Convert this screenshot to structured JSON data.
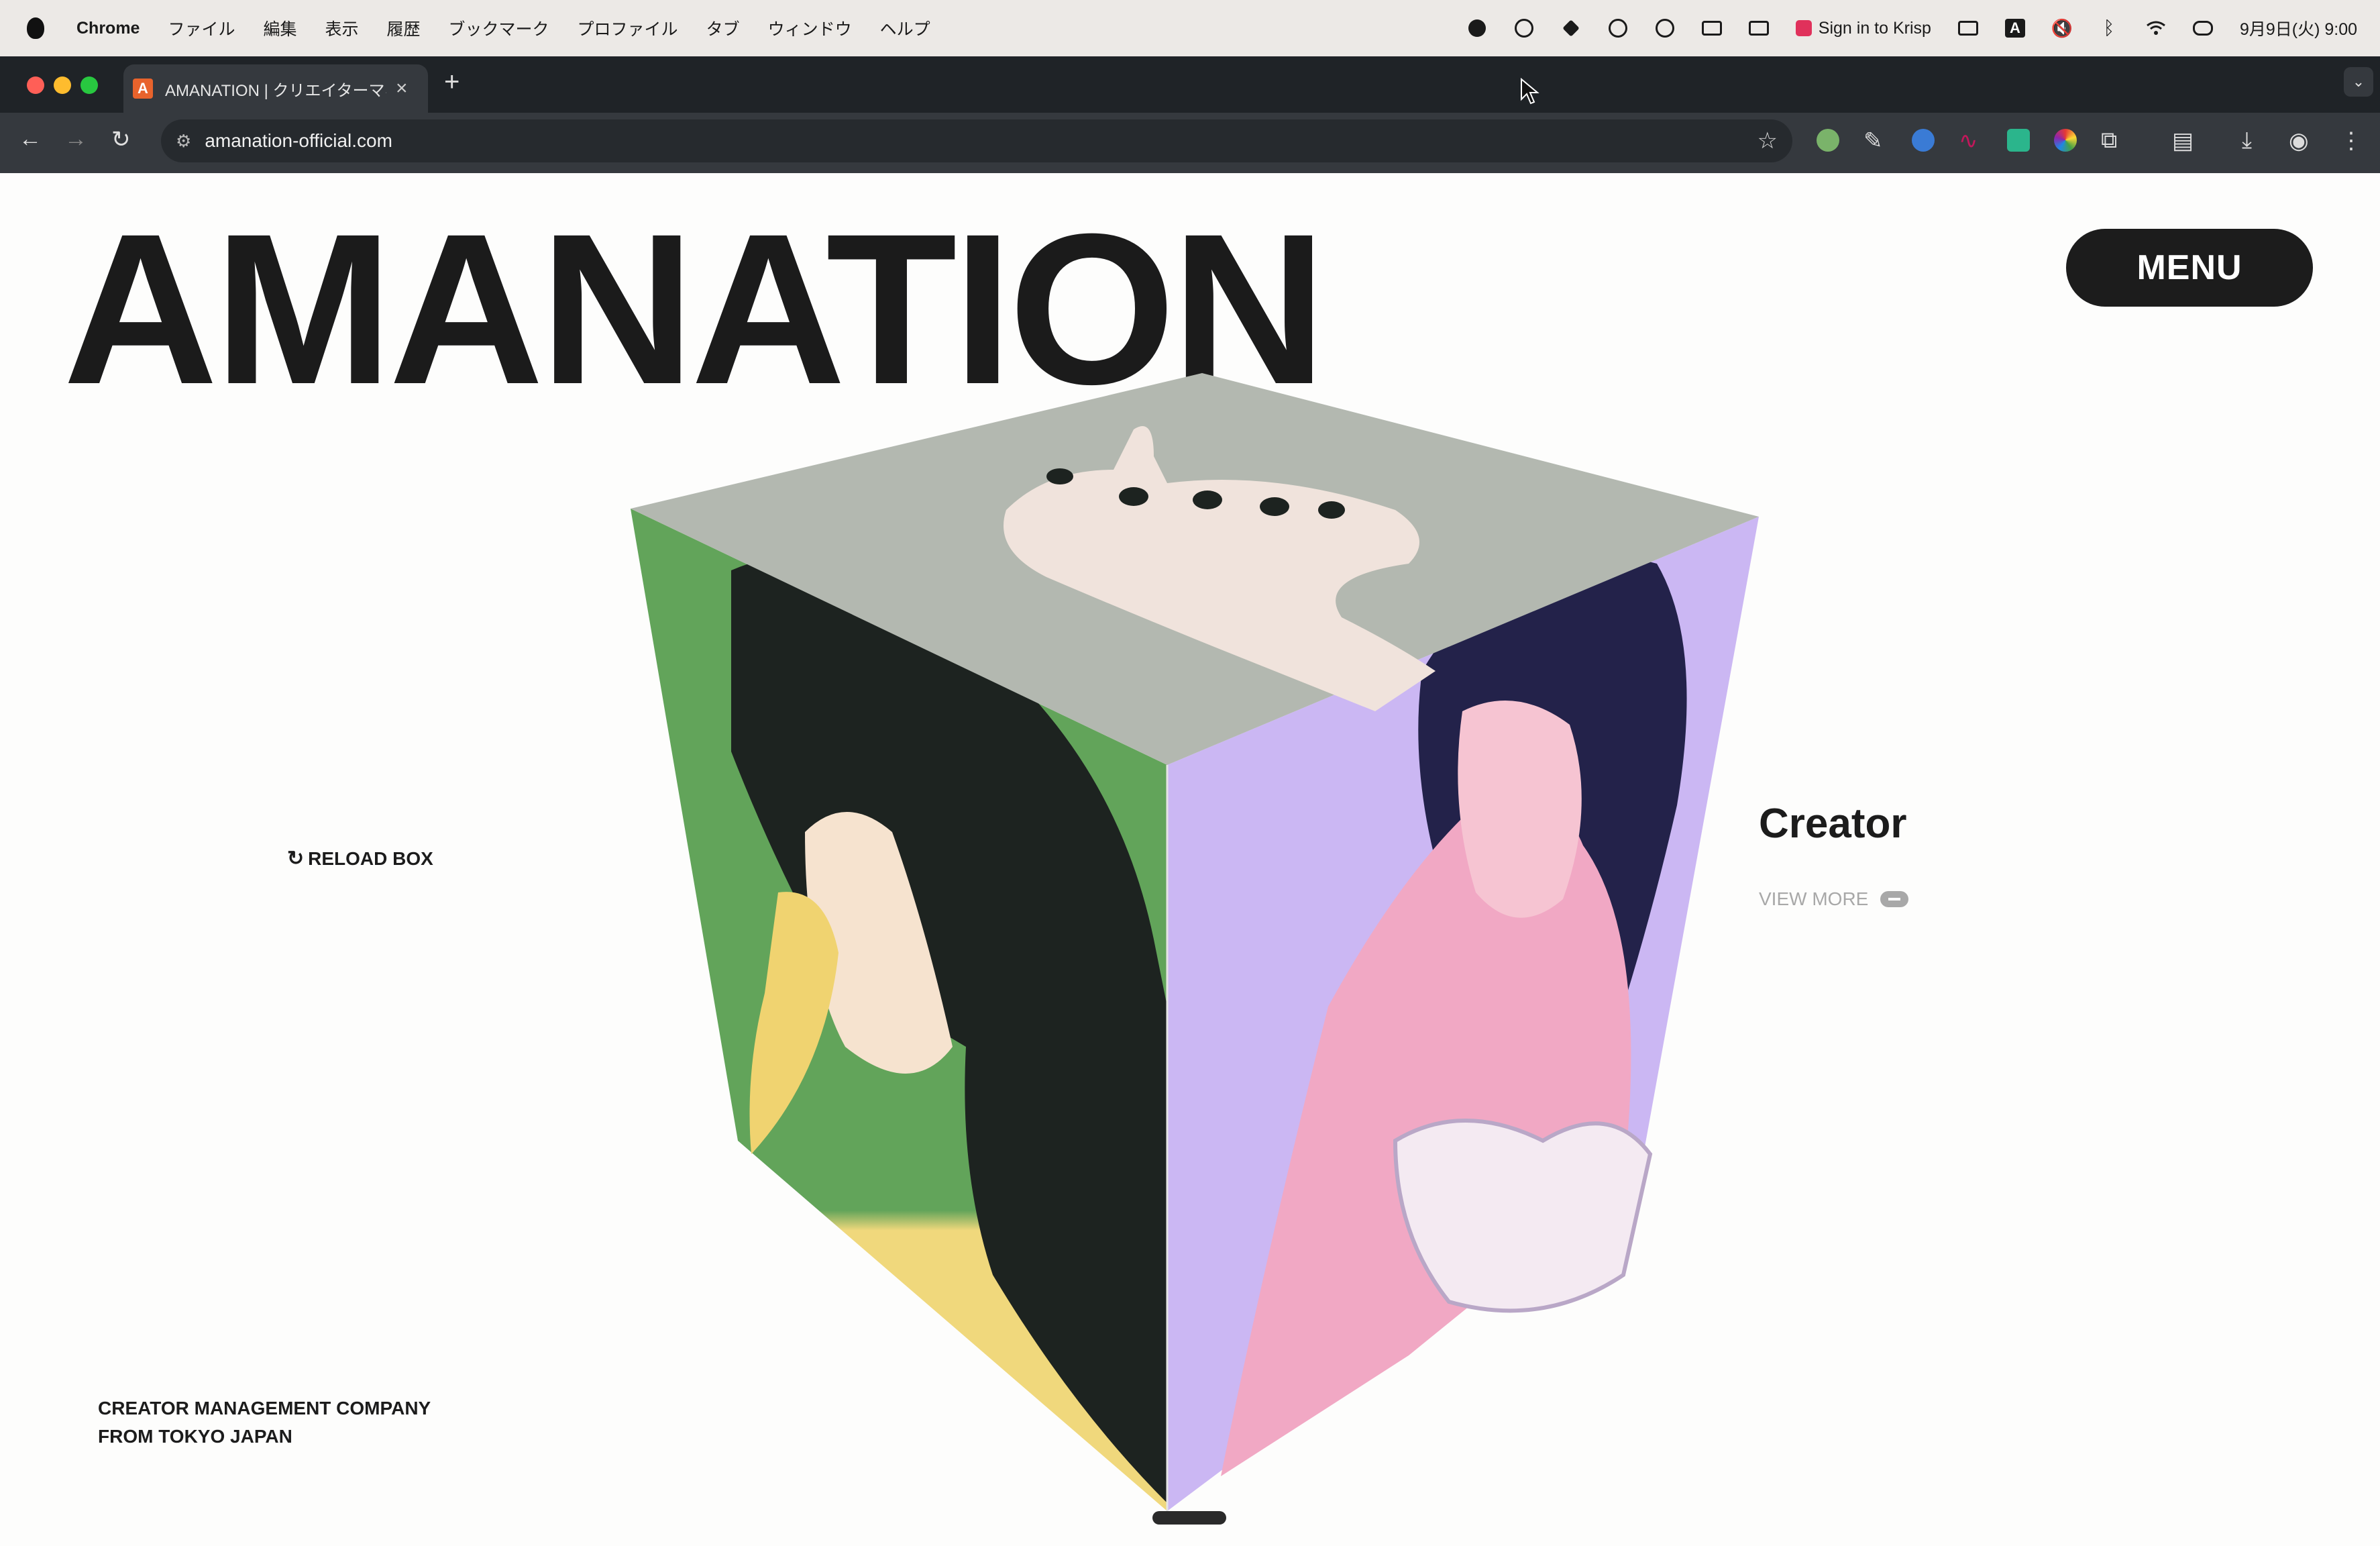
{
  "menubar": {
    "app": "Chrome",
    "items": [
      "ファイル",
      "編集",
      "表示",
      "履歴",
      "ブックマーク",
      "プロファイル",
      "タブ",
      "ウィンドウ",
      "ヘルプ"
    ],
    "krisp": "Sign in to Krisp",
    "clock": "9月9日(火)  9:00",
    "tray_icons": [
      "record-icon",
      "cloud-sync-icon",
      "dropbox-icon",
      "onepassword-icon",
      "circle-icon",
      "display-icon",
      "battery-icon",
      "krisp-icon",
      "keyboard-icon",
      "input-a-icon",
      "mute-icon",
      "bluetooth-icon",
      "wifi-icon",
      "control-center-icon"
    ]
  },
  "browser": {
    "tab_title": "AMANATION | クリエイターマネジメント",
    "tab_favicon": "A",
    "url": "amanation-official.com",
    "extensions": [
      "extension-green-icon",
      "dropper-icon",
      "onepassword-ext-icon",
      "link-ext-icon",
      "grammar-ext-icon",
      "color-ext-icon",
      "puzzle-icon",
      "sidepanel-icon",
      "download-icon",
      "profile-icon",
      "more-icon"
    ]
  },
  "page": {
    "brand": "AMANATION",
    "menu_label": "MENU",
    "reload_label": "RELOAD BOX",
    "side_title": "Creator",
    "view_more": "VIEW MORE",
    "tagline_1": "CREATOR MANAGEMENT COMPANY",
    "tagline_2": "FROM TOKYO JAPAN"
  },
  "colors": {
    "menu_button": "#1c1c1c",
    "cube_top": "#b3b8b0",
    "cube_left": "#62a45a",
    "cube_right": "#cbb7f3",
    "cube_left_bottom": "#f0d87c"
  }
}
